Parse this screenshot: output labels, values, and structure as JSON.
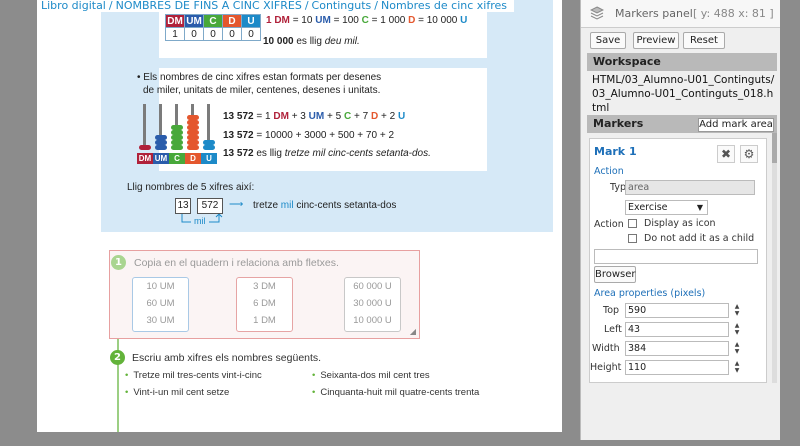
{
  "breadcrumb": [
    "Libro digital",
    "/",
    "NOMBRES DE FINS A CINC XIFRES",
    "/",
    "Continguts",
    "/",
    "Nombres de cinc xifres"
  ],
  "place_value_table": {
    "headers": [
      {
        "label": "DM",
        "color": "#b0213a"
      },
      {
        "label": "UM",
        "color": "#2a5cab"
      },
      {
        "label": "C",
        "color": "#48a83a"
      },
      {
        "label": "D",
        "color": "#e4572e"
      },
      {
        "label": "U",
        "color": "#1d8ac8"
      }
    ],
    "values": [
      "1",
      "0",
      "0",
      "0",
      "0"
    ]
  },
  "equivalence": {
    "dm": "1 DM",
    "eq1": "= 10",
    "um": "UM",
    "eq2": "= 100",
    "c": "C",
    "eq3": "= 1 000",
    "d": "D",
    "eq4": "= 10 000",
    "u": "U"
  },
  "reading1": {
    "num": "10 000",
    "text": "es llig",
    "words": "deu mil."
  },
  "info_paragraph": [
    "Els nombres de cinc xifres estan formats per desenes",
    "de miler, unitats de miler, centenes, desenes i unitats."
  ],
  "decomposition": {
    "line1": {
      "num": "13 572",
      "p1": "= 1",
      "dm": "DM",
      "p2": "+ 3",
      "um": "UM",
      "p3": "+ 5",
      "c": "C",
      "p4": "+ 7",
      "d": "D",
      "p5": "+ 2",
      "u": "U"
    },
    "line2": {
      "num": "13 572",
      "rest": "= 10000 + 3000 + 500 + 70 + 2"
    },
    "line3": {
      "num": "13 572",
      "text": "es llig",
      "words": "tretze mil cinc-cents setanta-dos."
    }
  },
  "abacus_labels": [
    "DM",
    "UM",
    "C",
    "D",
    "U"
  ],
  "read_title": "Llig nombres de 5 xifres així:",
  "read_example": {
    "box1": "13",
    "box2": "572",
    "arrow": "⟶",
    "text1": "tretze",
    "mil": "mil",
    "text2": "cinc-cents setanta-dos",
    "under_label": "mil"
  },
  "exercise1": {
    "number": "1",
    "title": "Copia en el quadern i relaciona amb fletxes.",
    "col1": [
      "10 UM",
      "60 UM",
      "30 UM"
    ],
    "col2": [
      "3 DM",
      "6 DM",
      "1 DM"
    ],
    "col3": [
      "60 000 U",
      "30 000 U",
      "10 000 U"
    ]
  },
  "exercise2": {
    "number": "2",
    "title": "Escriu amb xifres els nombres següents.",
    "items": [
      "Tretze mil tres-cents vint-i-cinc",
      "Seixanta-dos mil cent tres",
      "Vint-i-un mil cent setze",
      "Cinquanta-huit mil quatre-cents trenta"
    ]
  },
  "panel": {
    "title": "Markers panel",
    "coords": "[ y: 488 x: 81 ]",
    "buttons": {
      "save": "Save",
      "preview": "Preview",
      "reset": "Reset"
    },
    "workspace_header": "Workspace",
    "workspace_path": "HTML/03_Alumno-U01_Continguts/03_Alumno-U01_Continguts_018.html",
    "markers_header": "Markers",
    "add_mark": "Add mark area",
    "mark": {
      "title": "Mark 1",
      "action_label": "Action",
      "type_label": "Type",
      "type_value": "area",
      "action_select": "Exercise",
      "action2_label": "Action",
      "display_icon": "Display as icon",
      "no_child": "Do not add it as a child",
      "browser": "Browser",
      "props_label": "Area properties (pixels)",
      "top_label": "Top",
      "top": "590",
      "left_label": "Left",
      "left": "43",
      "width_label": "Width",
      "width": "384",
      "height_label": "Height",
      "height": "110"
    }
  }
}
